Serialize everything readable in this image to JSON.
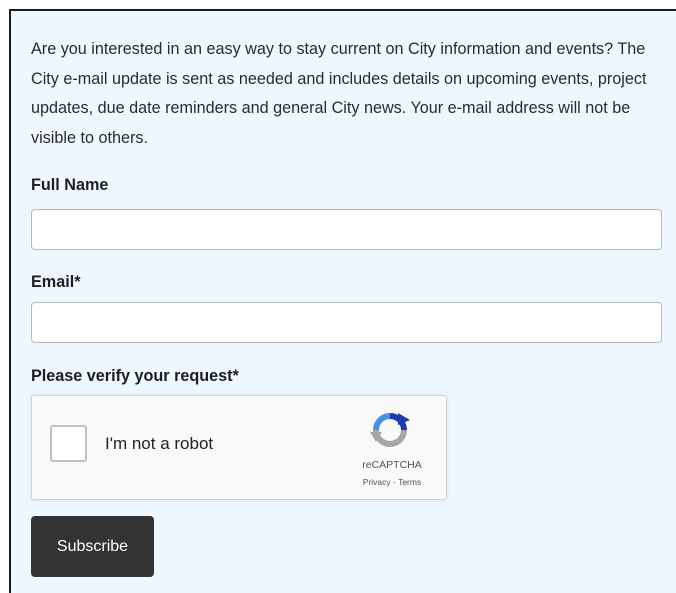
{
  "intro_text": "Are you interested in an easy way to stay current on City information and events? The City e-mail update is sent as needed and includes details on upcoming events, project updates, due date reminders and general City news. Your e-mail address will not be visible to others.",
  "form": {
    "full_name_label": "Full Name",
    "full_name_value": "",
    "email_label": "Email*",
    "email_value": "",
    "verify_label": "Please verify your request*"
  },
  "captcha": {
    "checkbox_label": "I'm not a robot",
    "checked": false,
    "brand": "reCAPTCHA",
    "privacy_link": "Privacy",
    "separator": " - ",
    "terms_link": "Terms"
  },
  "subscribe_button": "Subscribe",
  "colors": {
    "panel_background": "#eef7ff",
    "button_background": "#333333",
    "button_text": "#ffffff"
  }
}
